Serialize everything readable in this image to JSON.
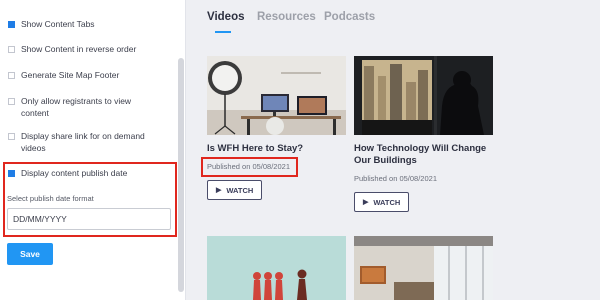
{
  "settings": {
    "options": [
      {
        "label": "Show Content Tabs",
        "checked": true
      },
      {
        "label": "Show Content in reverse order",
        "checked": false
      },
      {
        "label": "Generate Site Map Footer",
        "checked": false
      },
      {
        "label": "Only allow registrants to view content",
        "checked": false
      },
      {
        "label": "Display share link for on demand videos",
        "checked": false
      },
      {
        "label": "Display content publish date",
        "checked": true
      }
    ],
    "date_format_label": "Select publish date format",
    "date_format_value": "DD/MM/YYYY",
    "save_label": "Save"
  },
  "preview": {
    "tabs": [
      "Videos",
      "Resources",
      "Podcasts"
    ],
    "cards": [
      {
        "title": "Is WFH Here to Stay?",
        "date": "Published on 05/08/2021",
        "watch": "WATCH"
      },
      {
        "title": "How Technology Will Change Our Buildings",
        "date": "Published on 05/08/2021",
        "watch": "WATCH"
      }
    ]
  },
  "colors": {
    "accent": "#2196f3",
    "highlight": "#e0271e",
    "checkbox_checked": "#1f7de6"
  }
}
